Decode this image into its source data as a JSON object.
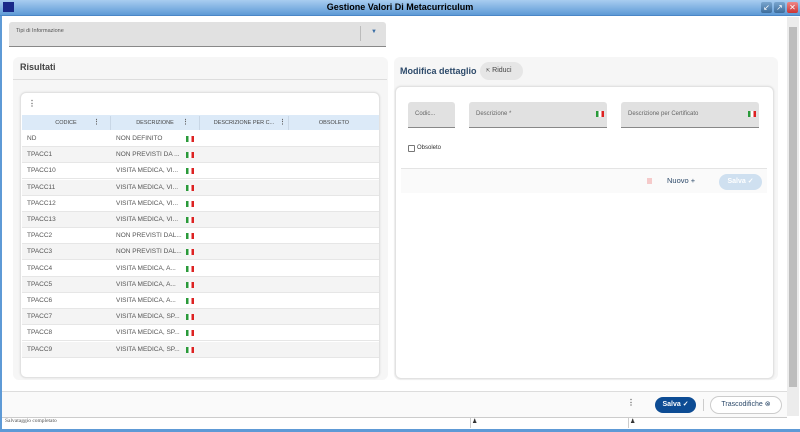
{
  "window": {
    "title": "Gestione Valori Di Metacurriculum"
  },
  "filter": {
    "label": "Tipi di Informazione"
  },
  "results": {
    "title": "Risultati",
    "columns": [
      "CODICE",
      "DESCRIZIONE",
      "DESCRIZIONE PER C...",
      "OBSOLETO"
    ],
    "rows": [
      {
        "code": "ND",
        "desc": "NON DEFINITO"
      },
      {
        "code": "TPACC1",
        "desc": "NON PREVISTI DA ..."
      },
      {
        "code": "TPACC10",
        "desc": "VISITA MEDICA, VI..."
      },
      {
        "code": "TPACC11",
        "desc": "VISITA MEDICA, VI..."
      },
      {
        "code": "TPACC12",
        "desc": "VISITA MEDICA, VI..."
      },
      {
        "code": "TPACC13",
        "desc": "VISITA MEDICA, VI..."
      },
      {
        "code": "TPACC2",
        "desc": "NON PREVISTI DAL..."
      },
      {
        "code": "TPACC3",
        "desc": "NON PREVISTI DAL..."
      },
      {
        "code": "TPACC4",
        "desc": "VISITA MEDICA, A..."
      },
      {
        "code": "TPACC5",
        "desc": "VISITA MEDICA, A..."
      },
      {
        "code": "TPACC6",
        "desc": "VISITA MEDICA, A..."
      },
      {
        "code": "TPACC7",
        "desc": "VISITA MEDICA, SP..."
      },
      {
        "code": "TPACC8",
        "desc": "VISITA MEDICA, SP..."
      },
      {
        "code": "TPACC9",
        "desc": "VISITA MEDICA, SP..."
      }
    ]
  },
  "detail": {
    "title": "Modifica dettaglio",
    "collapse": "Riduci",
    "code_label": "Codic...",
    "desc_label": "Descrizione *",
    "cert_label": "Descrizione per Certificato",
    "obsolete_label": "Obsoleto",
    "new_label": "Nuovo",
    "save_label": "Salva"
  },
  "footer": {
    "save": "Salva",
    "transcode": "Trascodifiche"
  },
  "status": {
    "text": "Salvataggio completato"
  }
}
